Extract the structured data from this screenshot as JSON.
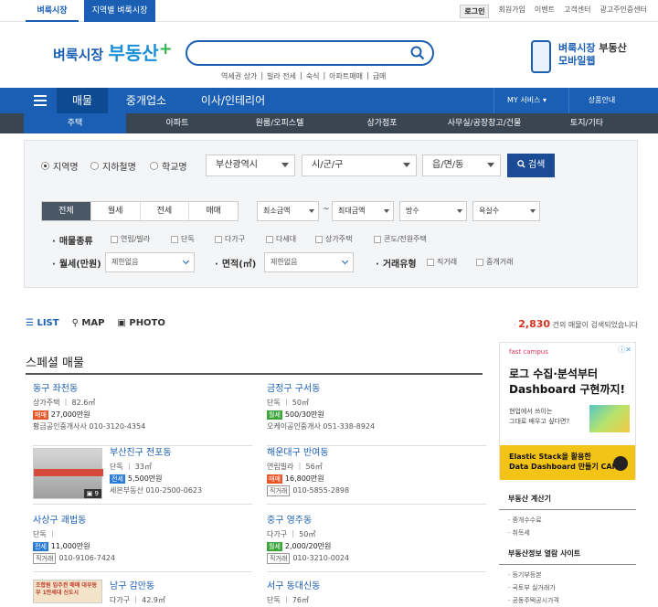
{
  "topbar": {
    "tab_active": "벼룩시장",
    "tab_other": "지역별 벼룩시장",
    "links": [
      "로그인",
      "회원가입",
      "이벤트",
      "고객센터",
      "광고주인증센터"
    ]
  },
  "header": {
    "logo_a": "벼룩시장",
    "logo_b": "부동산",
    "logo_plus": "+",
    "search_keywords": [
      "역세권 상가",
      "|",
      "빌라 전세",
      "|",
      "숙식",
      "|",
      "아파트매매",
      "|",
      "급매"
    ],
    "mobile_a": "벼룩시장",
    "mobile_b": "부동산",
    "mobile_c": "모바일웹"
  },
  "nav": {
    "items": [
      "매물",
      "중개업소",
      "이사/인테리어"
    ],
    "my_service": "MY 서비스 ▾",
    "guide": "상품안내"
  },
  "subnav": [
    "주택",
    "아파트",
    "원룸/오피스텔",
    "상가점포",
    "사무실/공장창고/건물",
    "토지/기타"
  ],
  "filter": {
    "radios": [
      "지역명",
      "지하철명",
      "학교명"
    ],
    "province": "부산광역시",
    "city": "시/군/구",
    "town": "읍/면/동",
    "search_btn": "검색",
    "deal_tabs": [
      "전체",
      "월세",
      "전세",
      "매매"
    ],
    "min_price": "최소금액",
    "tilde": "~",
    "max_price": "최대금액",
    "rooms": "방수",
    "baths": "욕실수",
    "type_label": "매물종류",
    "types": [
      "연립/빌라",
      "단독",
      "다가구",
      "다세대",
      "상가주택",
      "콘도/전원주택"
    ],
    "rent_label": "월세(만원)",
    "rent_value": "제한없음",
    "area_label": "면적(㎡)",
    "area_value": "제한없음",
    "deal_type_label": "거래유형",
    "deal_types": [
      "직거래",
      "중개거래"
    ]
  },
  "list": {
    "tabs": [
      "LIST",
      "MAP",
      "PHOTO"
    ],
    "count_num": "2,830",
    "count_text": "건의 매물이 검색되었습니다",
    "special_title": "스페셜 매물",
    "cards": [
      {
        "loc": "동구 좌천동",
        "info": "상가주택 ｜ 82.6㎡",
        "tag": "매매",
        "tag_color": "red",
        "price": "27,000만원",
        "agent": "황금공인중개사사 010-3120-4354"
      },
      {
        "loc": "금정구 구서동",
        "info": "단독 ｜ 50㎡",
        "tag": "월세",
        "tag_color": "green",
        "price": "500/30만원",
        "agent": "오케이공인중개사 051-338-8924"
      },
      {
        "loc": "부산진구 전포동",
        "info": "단독 ｜ 33㎡",
        "tag": "전세",
        "tag_color": "blue",
        "price": "5,500만원",
        "agent": "세븐부동산 010-2500-0623",
        "photo_count": "9"
      },
      {
        "loc": "해운대구 반여동",
        "info": "연립빌라 ｜ 56㎡",
        "tag": "매매",
        "tag_color": "red",
        "price": "16,800만원",
        "agent_tag": "직거래",
        "agent": "010-5855-2898"
      },
      {
        "loc": "사상구 괘법동",
        "info": "단독 ｜",
        "tag": "전세",
        "tag_color": "blue",
        "price": "11,000만원",
        "agent_tag": "직거래",
        "agent": "010-9106-7424"
      },
      {
        "loc": "중구 영주동",
        "info": "다가구 ｜ 50㎡",
        "tag": "월세",
        "tag_color": "green",
        "price": "2,000/20만원",
        "agent_tag": "직거래",
        "agent": "010-3210-0024"
      },
      {
        "loc": "남구 감만동",
        "info": "다가구 ｜ 42.9㎡",
        "img_text": "조합원 입주권 매매 대우동부 1만세대 신도시"
      },
      {
        "loc": "서구 동대신동",
        "info": "단독 ｜ 76㎡"
      }
    ]
  },
  "ad": {
    "brand": "fast campus",
    "headline_1": "로그 수집·분석부터",
    "headline_2": "Dashboard 구현까지!",
    "sub_1": "현업에서 쓰이는",
    "sub_2": "그대로 배우고 싶다면?",
    "foot_1": "Elastic Stack을 활용한",
    "foot_2": "Data Dashboard 만들기 CAMP"
  },
  "sidebar": {
    "calc_title": "부동산 계산기",
    "calc_items": [
      "· 중개수수료",
      "· 취득세"
    ],
    "sites_title": "부동산정보 열람 사이트",
    "site_items": [
      "· 등기부등본",
      "· 국토부 실거래가",
      "· 공동주택공시가격"
    ]
  },
  "colors": {
    "brand": "#1a5fb4",
    "subnav": "#3a4552",
    "accent_red": "#d9321f"
  }
}
